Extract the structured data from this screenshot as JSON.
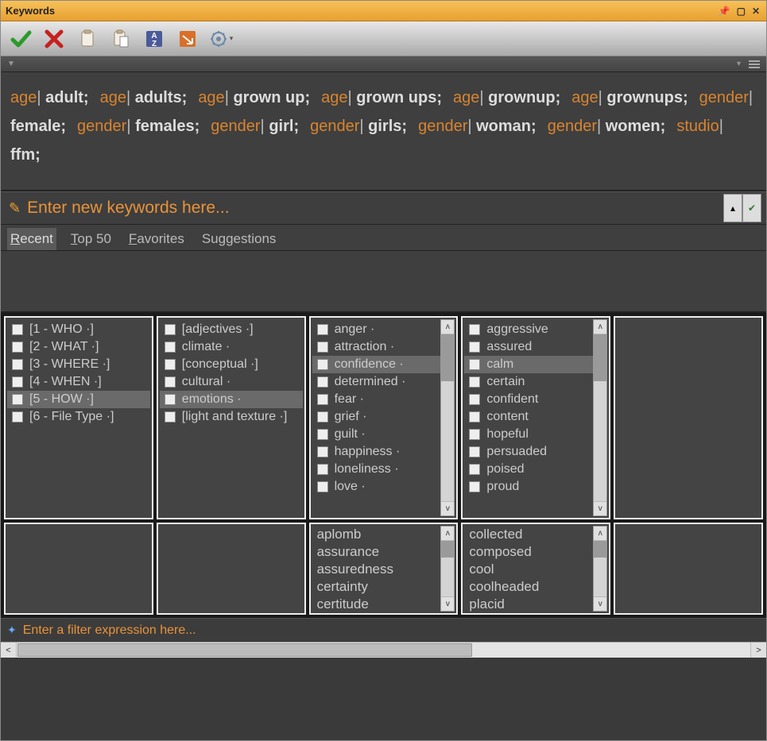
{
  "window": {
    "title": "Keywords"
  },
  "toolbar": {
    "accept": "Accept",
    "cancel": "Cancel",
    "copy": "Copy",
    "paste": "Paste",
    "sort": "Sort A-Z",
    "apply": "Apply",
    "settings": "Settings"
  },
  "keywords": [
    {
      "cat": "age",
      "val": "adult"
    },
    {
      "cat": "age",
      "val": "adults"
    },
    {
      "cat": "age",
      "val": "grown up"
    },
    {
      "cat": "age",
      "val": "grown ups"
    },
    {
      "cat": "age",
      "val": "grownup"
    },
    {
      "cat": "age",
      "val": "grownups"
    },
    {
      "cat": "gender",
      "val": "female"
    },
    {
      "cat": "gender",
      "val": "females"
    },
    {
      "cat": "gender",
      "val": "girl"
    },
    {
      "cat": "gender",
      "val": "girls"
    },
    {
      "cat": "gender",
      "val": "woman"
    },
    {
      "cat": "gender",
      "val": "women"
    },
    {
      "cat": "studio",
      "val": "ffm"
    }
  ],
  "entry": {
    "placeholder": "Enter new keywords here..."
  },
  "tabs": {
    "recent": "Recent",
    "top50": "Top 50",
    "favorites": "Favorites",
    "suggestions": "Suggestions"
  },
  "col1": [
    {
      "label": "[1 - WHO ·]"
    },
    {
      "label": "[2 - WHAT ·]"
    },
    {
      "label": "[3 - WHERE ·]"
    },
    {
      "label": "[4 - WHEN ·]"
    },
    {
      "label": "[5 - HOW ·]",
      "sel": true
    },
    {
      "label": "[6 - File Type ·]"
    }
  ],
  "col2": [
    {
      "label": "[adjectives ·]"
    },
    {
      "label": "climate ·"
    },
    {
      "label": "[conceptual ·]"
    },
    {
      "label": "cultural ·"
    },
    {
      "label": "emotions ·",
      "sel": true
    },
    {
      "label": "[light and texture ·]"
    }
  ],
  "col3": [
    {
      "label": "anger ·"
    },
    {
      "label": "attraction ·"
    },
    {
      "label": "confidence ·",
      "sel": true
    },
    {
      "label": "determined ·"
    },
    {
      "label": "fear ·"
    },
    {
      "label": "grief ·"
    },
    {
      "label": "guilt ·"
    },
    {
      "label": "happiness ·"
    },
    {
      "label": "loneliness ·"
    },
    {
      "label": "love ·"
    }
  ],
  "col4": [
    {
      "label": "aggressive"
    },
    {
      "label": "assured"
    },
    {
      "label": "calm",
      "sel": true
    },
    {
      "label": "certain"
    },
    {
      "label": "confident"
    },
    {
      "label": "content"
    },
    {
      "label": "hopeful"
    },
    {
      "label": "persuaded"
    },
    {
      "label": "poised"
    },
    {
      "label": "proud"
    }
  ],
  "syn1": [
    "aplomb",
    "assurance",
    "assuredness",
    "certainty",
    "certitude"
  ],
  "syn2": [
    "collected",
    "composed",
    "cool",
    "coolheaded",
    "placid"
  ],
  "filter": {
    "placeholder": "Enter a filter expression here..."
  }
}
